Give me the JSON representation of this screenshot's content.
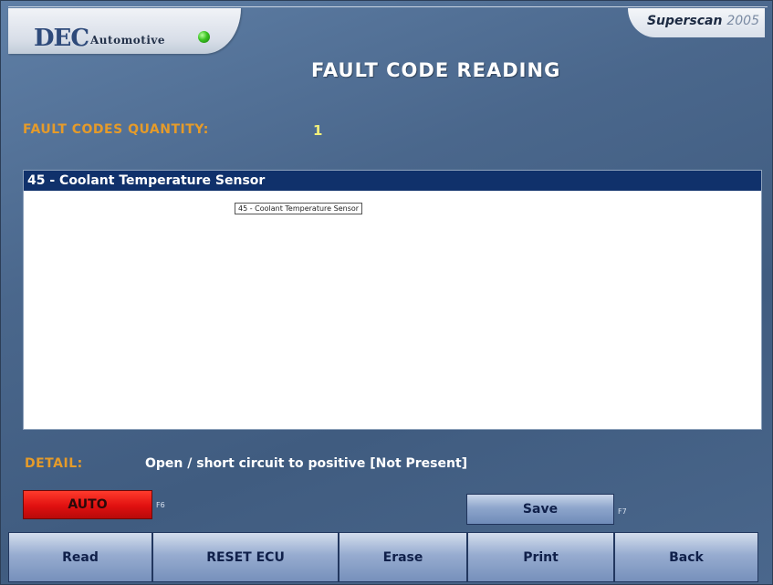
{
  "header": {
    "brand": "DEC",
    "brand_sub": "Automotive",
    "product": "Superscan",
    "product_year": "2005",
    "page_title": "FAULT CODE READING"
  },
  "status": {
    "led_color": "#39c21f"
  },
  "fault_codes": {
    "quantity_label": "FAULT CODES QUANTITY:",
    "quantity_value": "1",
    "items": [
      "45 - Coolant Temperature Sensor"
    ],
    "tooltip": "45 - Coolant Temperature Sensor"
  },
  "detail": {
    "label": "DETAIL:",
    "text": "Open / short circuit to positive  [Not Present]"
  },
  "controls": {
    "auto_label": "AUTO",
    "auto_hotkey": "F6",
    "save_label": "Save",
    "save_hotkey": "F7"
  },
  "toolbar": {
    "read_label": "Read",
    "reset_label": "RESET ECU",
    "erase_label": "Erase",
    "print_label": "Print",
    "back_label": "Back"
  },
  "colors": {
    "accent_orange": "#e59b2a",
    "quantity_yellow": "#f3f07a",
    "selection_blue": "#10316b",
    "auto_red": "#e01010"
  }
}
